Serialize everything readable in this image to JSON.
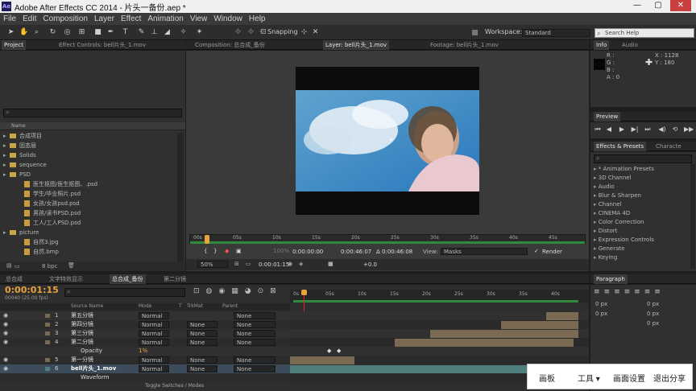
{
  "app": {
    "title": "Adobe After Effects CC 2014 - 片头一备份.aep *",
    "logo": "Ae",
    "window_controls": [
      "—",
      "▢",
      "✕"
    ]
  },
  "menu": [
    "File",
    "Edit",
    "Composition",
    "Layer",
    "Effect",
    "Animation",
    "View",
    "Window",
    "Help"
  ],
  "toolbar": {
    "snapping_label": "Snapping",
    "workspace_label": "Workspace:",
    "workspace_value": "Standard",
    "search_placeholder": "Search Help"
  },
  "project_panel": {
    "tabs": [
      "Project",
      "Effect Controls: bell片头_1.mov"
    ],
    "column_name": "Name",
    "items": [
      {
        "name": "合成项目",
        "type": "folder",
        "level": 0
      },
      {
        "name": "固态层",
        "type": "folder",
        "level": 0
      },
      {
        "name": "Solids",
        "type": "folder",
        "level": 0
      },
      {
        "name": "sequence",
        "type": "folder",
        "level": 0
      },
      {
        "name": "PSD",
        "type": "folder",
        "level": 0
      },
      {
        "name": "医生抠图/医生抠图、.psd",
        "type": "file",
        "level": 1
      },
      {
        "name": "学生/毕业照片.psd",
        "type": "file",
        "level": 1
      },
      {
        "name": "女孩/女孩psd.psd",
        "type": "file",
        "level": 1
      },
      {
        "name": "男孩/读书PSD.psd",
        "type": "file",
        "level": 1
      },
      {
        "name": "工人/工人PSD.psd",
        "type": "file",
        "level": 1
      },
      {
        "name": "picture",
        "type": "folder",
        "level": 0
      },
      {
        "name": "自然3.jpg",
        "type": "file",
        "level": 1
      },
      {
        "name": "自然.bmp",
        "type": "file",
        "level": 1
      }
    ],
    "bpc": "8 bpc"
  },
  "comp_panel": {
    "tabs": [
      "Composition: 总合成_备份",
      "Layer: bell片头_1.mov",
      "Footage: bell片头_1.mov"
    ],
    "ruler_labels": [
      "00s",
      "05s",
      "10s",
      "15s",
      "20s",
      "25s",
      "30s",
      "35s",
      "40s",
      "45s"
    ],
    "in_time": "0:00:00:00",
    "out_time": "0:00:46:07",
    "duration": "Δ 0:00:46:08",
    "view_label": "View:",
    "view_value": "Masks",
    "render_label": "Render",
    "zoom": "50%",
    "current_time": "0:00:01:15",
    "exposure": "+0.0"
  },
  "info_panel": {
    "tabs": [
      "Info",
      "Audio"
    ],
    "r": "R :",
    "g": "G :",
    "b": "B :",
    "a": "A : 0",
    "x": "X : 1128",
    "y": "Y : 180"
  },
  "preview_panel": {
    "title": "Preview"
  },
  "effects_panel": {
    "tabs": [
      "Effects & Presets",
      "Characte"
    ],
    "items": [
      "* Animation Presets",
      "3D Channel",
      "Audio",
      "Blur & Sharpen",
      "Channel",
      "CINEMA 4D",
      "Color Correction",
      "Distort",
      "Expression Controls",
      "Generate",
      "Keying"
    ]
  },
  "paragraph_panel": {
    "title": "Paragraph",
    "values": [
      "0 px",
      "0 px",
      "0 px",
      "0 px",
      "0 px"
    ]
  },
  "timeline": {
    "tabs": [
      "总合成",
      "文字特效显示",
      "总合成_备份",
      "第二分镜"
    ],
    "current_time": "0:00:01:15",
    "fps": "00040 (25.00 fps)",
    "columns": {
      "source": "Source Name",
      "mode": "Mode",
      "t": "T",
      "trkmat": "TrkMat",
      "parent": "Parent"
    },
    "ruler_labels": [
      "0s",
      "05s",
      "10s",
      "15s",
      "20s",
      "25s",
      "30s",
      "35s",
      "40s"
    ],
    "layers": [
      {
        "num": "1",
        "name": "第五分镜",
        "mode": "Normal",
        "trkmat": "",
        "parent": "None",
        "color": "#7a6a52"
      },
      {
        "num": "2",
        "name": "第四分镜",
        "mode": "Normal",
        "trkmat": "None",
        "parent": "None",
        "color": "#7a6a52"
      },
      {
        "num": "3",
        "name": "第三分镜",
        "mode": "Normal",
        "trkmat": "None",
        "parent": "None",
        "color": "#7a6a52"
      },
      {
        "num": "4",
        "name": "第二分镜",
        "mode": "Normal",
        "trkmat": "None",
        "parent": "None",
        "color": "#7a6a52"
      },
      {
        "num": "",
        "name": "Opacity",
        "mode": "",
        "trkmat": "",
        "parent": "",
        "value": "1%",
        "color": ""
      },
      {
        "num": "5",
        "name": "第一分镜",
        "mode": "Normal",
        "trkmat": "None",
        "parent": "None",
        "color": "#7a6a52"
      },
      {
        "num": "6",
        "name": "bell片头_1.mov",
        "mode": "Normal",
        "trkmat": "None",
        "parent": "None",
        "color": "#4f7f7c"
      },
      {
        "num": "",
        "name": "Waveform",
        "mode": "",
        "trkmat": "",
        "parent": "",
        "color": ""
      }
    ],
    "toggle_label": "Toggle Switches / Modes"
  },
  "overlay_toolbar": [
    "画板",
    "工具 ▾",
    "画面设置",
    "退出分享"
  ],
  "colors": {
    "accent": "#e9a33b",
    "timebar": "#2f8a3e",
    "layer_brown": "#7a6a52",
    "layer_teal": "#4f7f7c"
  }
}
